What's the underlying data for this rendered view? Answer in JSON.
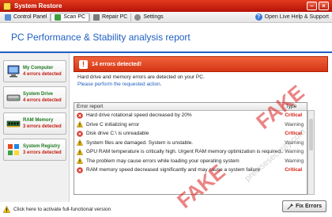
{
  "window": {
    "title": "System Restore"
  },
  "toolbar": {
    "items": [
      {
        "label": "Control Panel",
        "icon": "control-panel-icon"
      },
      {
        "label": "Scan PC",
        "icon": "scan-icon"
      },
      {
        "label": "Repair PC",
        "icon": "repair-icon"
      },
      {
        "label": "Settings",
        "icon": "gear-icon"
      }
    ],
    "help_label": "Open Live Help & Support"
  },
  "header": {
    "title": "PC Performance & Stability analysis report"
  },
  "sidebar": {
    "items": [
      {
        "name": "My Computer",
        "count": "4 errors detected"
      },
      {
        "name": "System Drive",
        "count": "4 errors detected"
      },
      {
        "name": "RAM Memory",
        "count": "3 errors detected"
      },
      {
        "name": "System Registry",
        "count": "3 errors detected"
      }
    ]
  },
  "alert": {
    "title": "14 errors detected!",
    "line1": "Hard drive and memory errors are detected on your PC.",
    "line2": "Please perform the requested action."
  },
  "report": {
    "columns": [
      "Error report",
      "Type"
    ],
    "rows": [
      {
        "icon": "error-icon",
        "text": "Hard drive rotational speed decreased by 20%",
        "type": "Critical"
      },
      {
        "icon": "warning-icon",
        "text": "Drive C initializing error",
        "type": "Warning"
      },
      {
        "icon": "error-icon",
        "text": "Disk drive C:\\ is unreadable",
        "type": "Critical"
      },
      {
        "icon": "warning-icon",
        "text": "System files are damaged. System is unstable.",
        "type": "Warning"
      },
      {
        "icon": "warning-icon",
        "text": "GPU RAM temperature is critically high. Urgent RAM memory optimization is required...",
        "type": "Warning"
      },
      {
        "icon": "warning-icon",
        "text": "The problem may cause errors while loading your operating system",
        "type": "Warning"
      },
      {
        "icon": "error-icon",
        "text": "RAM memory speed decreased significantly and may cause a system failure",
        "type": "Critical"
      }
    ]
  },
  "fix_button": {
    "label": "Fix Errors"
  },
  "status": {
    "text": "Click here to activate full-functional version"
  },
  "watermark": {
    "fake": "FAKE",
    "site": "precisesecurity.com"
  },
  "colors": {
    "title_bar": "#c8200e",
    "accent_blue": "#1f5fc2",
    "critical": "#d41a0e",
    "sidebar_name": "#1f7a1f"
  }
}
